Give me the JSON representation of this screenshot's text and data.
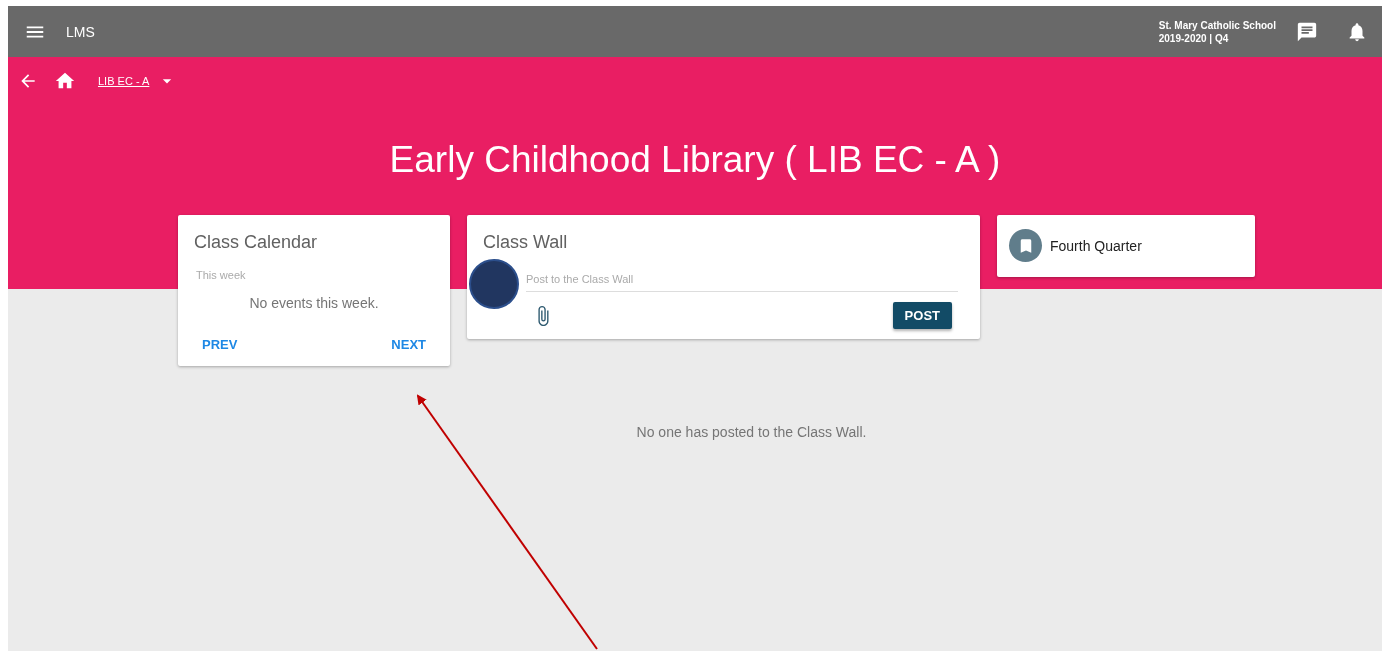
{
  "app_bar": {
    "title": "LMS",
    "school": "St. Mary Catholic School",
    "term": "2019-2020 | Q4"
  },
  "breadcrumb": {
    "label": "LIB EC - A"
  },
  "page_title": "Early Childhood Library ( LIB EC - A )",
  "calendar": {
    "title": "Class Calendar",
    "subtitle": "This week",
    "empty": "No events this week.",
    "prev": "PREV",
    "next": "NEXT"
  },
  "wall": {
    "title": "Class Wall",
    "placeholder": "Post to the Class Wall",
    "post": "POST",
    "empty": "No one has posted to the Class Wall."
  },
  "quarter": {
    "label": "Fourth Quarter"
  }
}
